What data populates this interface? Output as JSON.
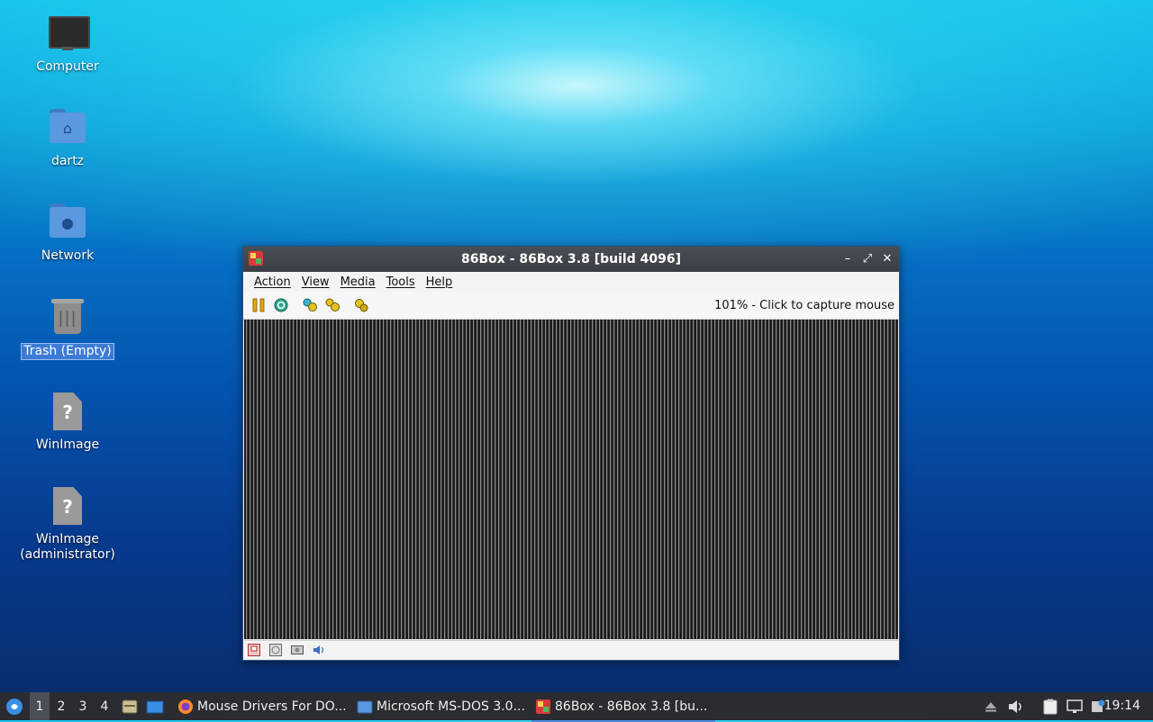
{
  "desktop": {
    "icons": [
      {
        "label": "Computer",
        "icon": "computer-icon"
      },
      {
        "label": "dartz",
        "icon": "home-folder-icon"
      },
      {
        "label": "Network",
        "icon": "network-folder-icon"
      },
      {
        "label": "Trash (Empty)",
        "icon": "trash-icon",
        "selected": true
      },
      {
        "label": "WinImage",
        "icon": "unknown-file-icon"
      },
      {
        "label": "WinImage\n(administrator)",
        "icon": "unknown-file-icon"
      }
    ]
  },
  "window": {
    "title": "86Box - 86Box 3.8 [build 4096]",
    "menu": [
      "Action",
      "View",
      "Media",
      "Tools",
      "Help"
    ],
    "toolbar_icons": [
      "pause-icon",
      "reset-icon",
      "ctrl-alt-del-icon",
      "ctrl-alt-esc-icon",
      "settings-icon"
    ],
    "status_text": "101% - Click to capture mouse",
    "statusbar_icons": [
      "floppy-icon",
      "cdrom-icon",
      "hdd-icon",
      "sound-icon"
    ]
  },
  "taskbar": {
    "workspaces": [
      "1",
      "2",
      "3",
      "4"
    ],
    "active_workspace": "1",
    "tasks": [
      {
        "label": "Mouse Drivers For DO...",
        "icon": "firefox-icon"
      },
      {
        "label": "Microsoft MS-DOS 3.0...",
        "icon": "folder-icon"
      },
      {
        "label": "86Box - 86Box 3.8 [bu...",
        "icon": "86box-icon",
        "active": true
      }
    ],
    "clock": "19:14"
  },
  "colors": {
    "taskbar_bg": "#2a2c31",
    "selection": "#3d7bd6",
    "titlebar_bg": "#3a3e44"
  }
}
